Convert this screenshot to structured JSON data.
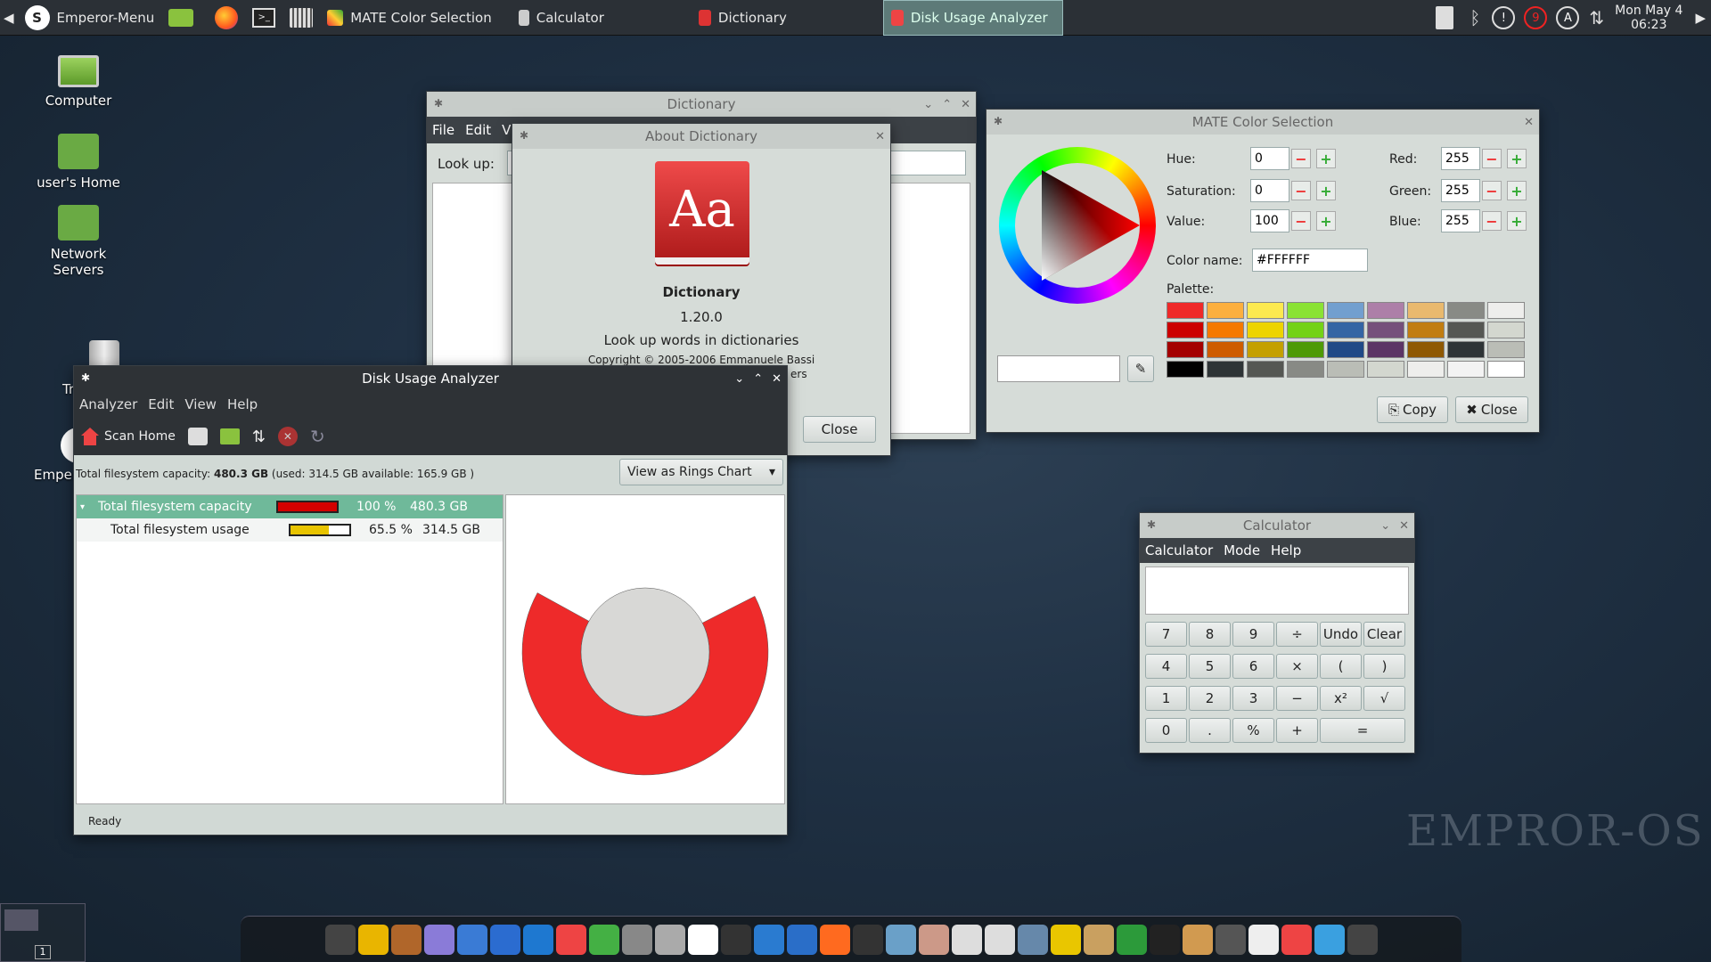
{
  "taskbar": {
    "menu_label": "Emperor-Menu",
    "tasks": [
      {
        "label": "MATE Color Selection",
        "active": false
      },
      {
        "label": "Calculator",
        "active": false
      },
      {
        "label": "Dictionary",
        "active": false
      },
      {
        "label": "Disk Usage Analyzer",
        "active": true
      }
    ],
    "notification_count": "9",
    "clock_date": "Mon May 4",
    "clock_time": "06:23"
  },
  "desktop": {
    "icons": [
      "Computer",
      "user's Home",
      "Network Servers",
      "Tr",
      "Emper"
    ],
    "watermark": "EMPROR-OS",
    "workspace": "1"
  },
  "dictionary": {
    "title": "Dictionary",
    "menu": [
      "File",
      "Edit",
      "Vie"
    ],
    "lookup_label": "Look up:"
  },
  "about_dictionary": {
    "title": "About Dictionary",
    "logo_text": "Aa",
    "name": "Dictionary",
    "version": "1.20.0",
    "description": "Look up words in dictionaries",
    "copyright": "Copyright © 2005-2006 Emmanuele Bassi",
    "copyright_tail": "ers",
    "close_label": "Close"
  },
  "disk_usage": {
    "title": "Disk Usage Analyzer",
    "menu": [
      "Analyzer",
      "Edit",
      "View",
      "Help"
    ],
    "scan_home_label": "Scan Home",
    "summary_prefix": "Total filesystem capacity: ",
    "summary_bold": "480.3 GB",
    "summary_suffix": " (used: 314.5 GB available: 165.9 GB )",
    "view_select": "View as Rings Chart",
    "rows": [
      {
        "name": "Total filesystem capacity",
        "percent": "100 %",
        "size": "480.3 GB",
        "fill": 1.0,
        "color": "#d40000"
      },
      {
        "name": "Total filesystem usage",
        "percent": "65.5 %",
        "size": "314.5 GB",
        "fill": 0.655,
        "color": "#e8c400"
      }
    ],
    "ring_fraction": 0.655,
    "ring_color": "#ee2a2a",
    "center_color": "#d8d8d6",
    "status": "Ready"
  },
  "color_selection": {
    "title": "MATE Color Selection",
    "labels": {
      "hue": "Hue:",
      "saturation": "Saturation:",
      "value": "Value:",
      "red": "Red:",
      "green": "Green:",
      "blue": "Blue:",
      "color_name": "Color name:",
      "palette": "Palette:"
    },
    "values": {
      "hue": "0",
      "saturation": "0",
      "value": "100",
      "red": "255",
      "green": "255",
      "blue": "255",
      "color_name": "#FFFFFF"
    },
    "palette": [
      [
        "#ef2929",
        "#fcaf3e",
        "#fce94f",
        "#8ae234",
        "#729fcf",
        "#ad7fa8",
        "#e9b96e",
        "#888a85",
        "#eeeeec"
      ],
      [
        "#cc0000",
        "#f57900",
        "#edd400",
        "#73d216",
        "#3465a4",
        "#75507b",
        "#c17d11",
        "#555753",
        "#d3d7cf"
      ],
      [
        "#a40000",
        "#ce5c00",
        "#c4a000",
        "#4e9a06",
        "#204a87",
        "#5c3566",
        "#8f5902",
        "#2e3436",
        "#babdb6"
      ],
      [
        "#000000",
        "#2e3436",
        "#555753",
        "#888a85",
        "#babdb6",
        "#d3d7cf",
        "#eeeeec",
        "#f3f3f3",
        "#ffffff"
      ]
    ],
    "copy_label": "Copy",
    "close_label": "Close"
  },
  "calculator": {
    "title": "Calculator",
    "menu": [
      "Calculator",
      "Mode",
      "Help"
    ],
    "display": "",
    "keys": [
      "7",
      "8",
      "9",
      "÷",
      "Undo",
      "Clear",
      "4",
      "5",
      "6",
      "×",
      "(",
      ")",
      "1",
      "2",
      "3",
      "−",
      "x²",
      "√",
      "0",
      ".",
      "%",
      "+",
      "="
    ]
  },
  "dock_icons": [
    "terminal",
    "pidgin",
    "gimp",
    "inkscape",
    "writer",
    "word",
    "vscode",
    "office",
    "qt",
    "printer",
    "scanner",
    "skype",
    "phone",
    "help",
    "bluetooth",
    "firefox",
    "media",
    "vpn",
    "files",
    "drive",
    "disc",
    "scanner2",
    "notes",
    "archive",
    "sync",
    "monitor",
    "packages",
    "calculator",
    "books",
    "chrome",
    "folder",
    "power"
  ]
}
